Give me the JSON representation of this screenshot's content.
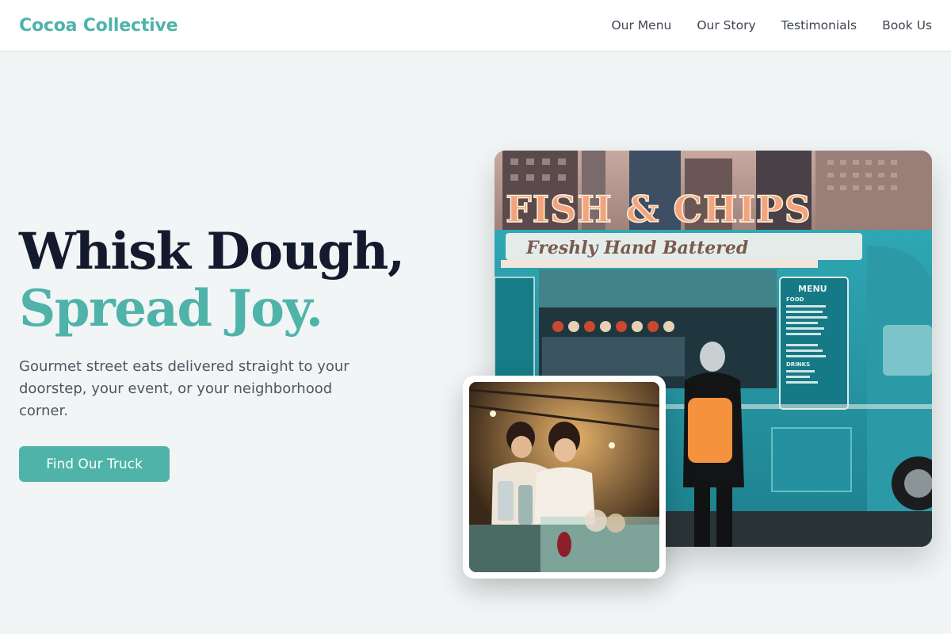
{
  "header": {
    "brand": "Cocoa Collective",
    "nav": [
      {
        "label": "Our Menu"
      },
      {
        "label": "Our Story"
      },
      {
        "label": "Testimonials"
      },
      {
        "label": "Book Us"
      }
    ]
  },
  "hero": {
    "title_line1": "Whisk Dough,",
    "title_line2": "Spread Joy.",
    "subtitle": "Gourmet street eats delivered straight to your doorstep, your event, or your neighborhood corner.",
    "cta_label": "Find Our Truck"
  },
  "images": {
    "main": {
      "subject": "food truck photo",
      "sign": "FISH & CHIPS",
      "awning_text": "Freshly Hand Battered",
      "menu_heading": "MENU",
      "menu_food": "FOOD",
      "menu_drinks": "DRINKS"
    },
    "inset": {
      "subject": "vendors at night market stall photo"
    }
  },
  "colors": {
    "accent": "#4fb3a9",
    "title_dark": "#141a2e",
    "body_text": "#4e5762",
    "page_bg": "#f1f5f5"
  }
}
